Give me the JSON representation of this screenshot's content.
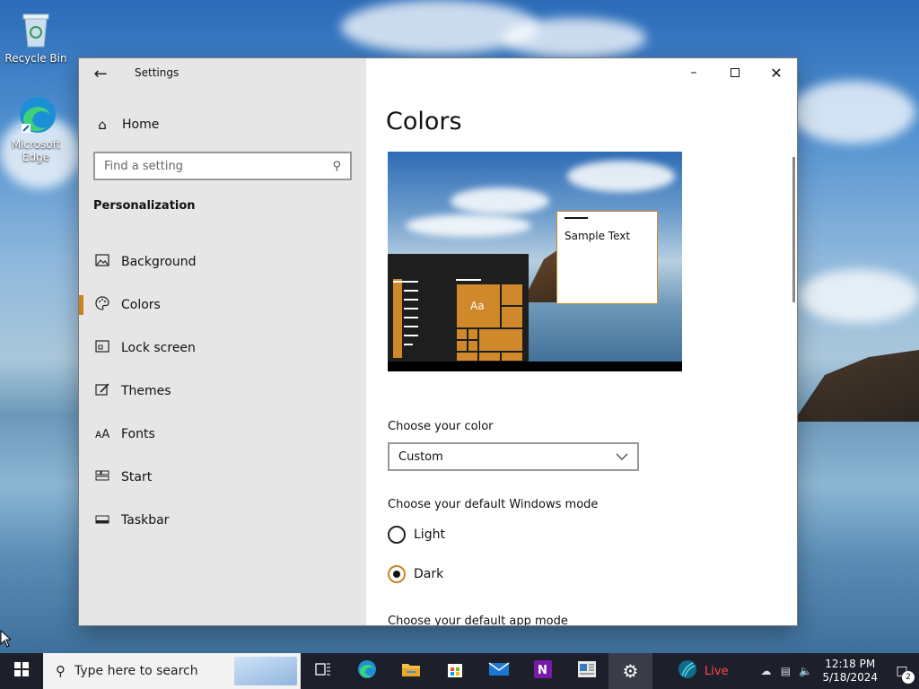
{
  "desktop": {
    "icons": [
      {
        "label": "Recycle Bin",
        "icon": "recycle-bin-icon"
      },
      {
        "label": "Microsoft Edge",
        "icon": "edge-icon"
      }
    ]
  },
  "window": {
    "title": "Settings",
    "controls": {
      "minimize": "minimize-icon",
      "maximize": "maximize-icon",
      "close": "close-icon"
    }
  },
  "sidebar": {
    "home_label": "Home",
    "search_placeholder": "Find a setting",
    "section_title": "Personalization",
    "items": [
      {
        "label": "Background",
        "icon": "picture-icon",
        "active": false
      },
      {
        "label": "Colors",
        "icon": "palette-icon",
        "active": true
      },
      {
        "label": "Lock screen",
        "icon": "lock-screen-icon",
        "active": false
      },
      {
        "label": "Themes",
        "icon": "brush-icon",
        "active": false
      },
      {
        "label": "Fonts",
        "icon": "font-icon",
        "active": false
      },
      {
        "label": "Start",
        "icon": "start-tiles-icon",
        "active": false
      },
      {
        "label": "Taskbar",
        "icon": "taskbar-icon",
        "active": false
      }
    ]
  },
  "main": {
    "title": "Colors",
    "preview": {
      "sample_text": "Sample Text",
      "tile_text": "Aa",
      "accent_color": "#d0892a"
    },
    "choose_color": {
      "label": "Choose your color",
      "selected": "Custom"
    },
    "windows_mode": {
      "label": "Choose your default Windows mode",
      "options": [
        {
          "label": "Light",
          "checked": false
        },
        {
          "label": "Dark",
          "checked": true
        }
      ]
    },
    "app_mode": {
      "label": "Choose your default app mode"
    }
  },
  "taskbar": {
    "search_placeholder": "Type here to search",
    "apps": [
      "task-view-icon",
      "edge-icon",
      "file-explorer-icon",
      "store-icon",
      "mail-icon",
      "onenote-icon",
      "news-icon",
      "settings-icon"
    ],
    "live_label": "Live",
    "time": "12:18 PM",
    "date": "5/18/2024",
    "notification_count": "2"
  }
}
